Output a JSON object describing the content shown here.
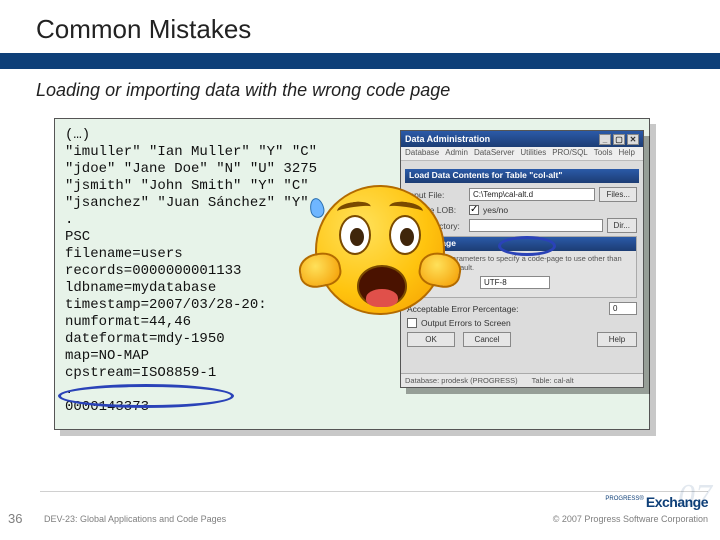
{
  "slide": {
    "title": "Common Mistakes",
    "subtitle": "Loading or importing data with the wrong code page"
  },
  "code": {
    "text": "(…)\n\"imuller\" \"Ian Muller\" \"Y\" \"C\"\n\"jdoe\" \"Jane Doe\" \"N\" \"U\" 3275\n\"jsmith\" \"John Smith\" \"Y\" \"C\"\n\"jsanchez\" \"Juan Sánchez\" \"Y\"\n.\nPSC\nfilename=users\nrecords=0000000001133\nldbname=mydatabase\ntimestamp=2007/03/28-20:\nnumformat=44,46\ndateformat=mdy-1950\nmap=NO-MAP\ncpstream=ISO8859-1\n.\n0000143373"
  },
  "dialog": {
    "title": "Data Administration",
    "menu": [
      "Database",
      "Admin",
      "DataServer",
      "Utilities",
      "PRO/SQL",
      "Tools",
      "Help"
    ],
    "sub_title": "Load Data Contents for Table \"col-alt\"",
    "input_file_label": "Input File:",
    "input_file_value": "C:\\Temp\\cal-alt.d",
    "files_btn": "Files...",
    "include_lob_label": "Include LOB:",
    "lob_chk_label": "yes/no",
    "inner": {
      "title": "Code Page",
      "info": "Use these parameters to specify a code-page to use other than the stream default.",
      "code_page_label": "Code Page",
      "code_page_value": "UTF-8",
      "dir_btn": "Dir..."
    },
    "lob_dir_label": "Lob Directory:",
    "err_label": "Acceptable Error Percentage:",
    "err_value": "0",
    "output_chk": "Output Errors to Screen",
    "ok": "OK",
    "cancel": "Cancel",
    "help": "Help",
    "status_db_label": "Database:",
    "status_db_value": "prodesk (PROGRESS)",
    "status_table_label": "Table:",
    "status_table_value": "cal-alt"
  },
  "footer": {
    "page": "36",
    "left": "DEV-23: Global Applications and Code Pages",
    "right": "© 2007 Progress Software Corporation",
    "logo_word": "Exchange",
    "logo_sup": "PROGRESS®",
    "logo_year": "07"
  }
}
